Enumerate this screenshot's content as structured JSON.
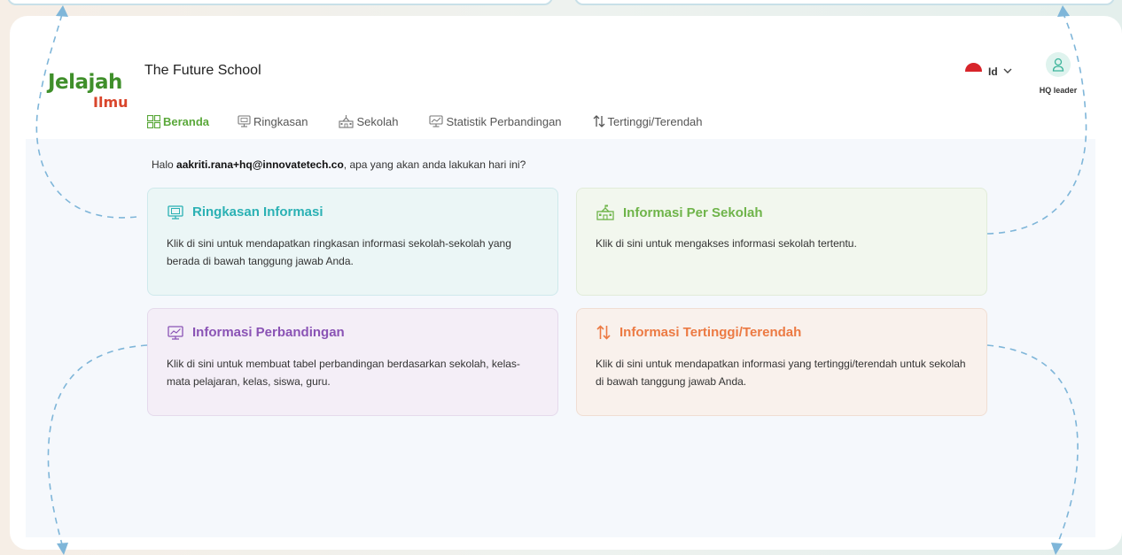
{
  "app": {
    "logo_line1": "Jelajah",
    "logo_line2": "Ilmu",
    "school_name": "The Future School"
  },
  "nav": {
    "items": [
      {
        "label": "Beranda",
        "icon": "grid-icon",
        "active": true
      },
      {
        "label": "Ringkasan",
        "icon": "monitor-icon",
        "active": false
      },
      {
        "label": "Sekolah",
        "icon": "school-icon",
        "active": false
      },
      {
        "label": "Statistik Perbandingan",
        "icon": "chart-monitor-icon",
        "active": false
      },
      {
        "label": "Tertinggi/Terendah",
        "icon": "sort-arrows-icon",
        "active": false
      }
    ]
  },
  "header": {
    "language": "Id",
    "language_flag": "indonesia-flag",
    "user_role": "HQ leader"
  },
  "greeting": {
    "prefix": "Halo ",
    "email": "aakriti.rana+hq@innovatetech.co",
    "suffix": ", apa yang akan anda lakukan hari ini?"
  },
  "tiles": [
    {
      "title": "Ringkasan Informasi",
      "icon": "monitor-icon",
      "desc": "Klik di sini untuk mendapatkan ringkasan informasi sekolah-sekolah yang berada di bawah tanggung jawab Anda.",
      "color": "#2bb1b4"
    },
    {
      "title": "Informasi Per Sekolah",
      "icon": "school-icon",
      "desc": "Klik di sini untuk mengakses informasi sekolah tertentu.",
      "color": "#6fb44a"
    },
    {
      "title": "Informasi Perbandingan",
      "icon": "chart-monitor-icon",
      "desc": "Klik di sini untuk membuat tabel perbandingan berdasarkan sekolah, kelas-mata pelajaran, kelas, siswa, guru.",
      "color": "#8a53b5"
    },
    {
      "title": "Informasi Tertinggi/Terendah",
      "icon": "sort-arrows-icon",
      "desc": "Klik di sini untuk mendapatkan informasi yang tertinggi/terendah untuk sekolah di bawah tanggung jawab Anda.",
      "color": "#ec7a43"
    }
  ],
  "colors": {
    "accent_green": "#5aa83a",
    "dashed_arrow": "#7fb6d9"
  }
}
